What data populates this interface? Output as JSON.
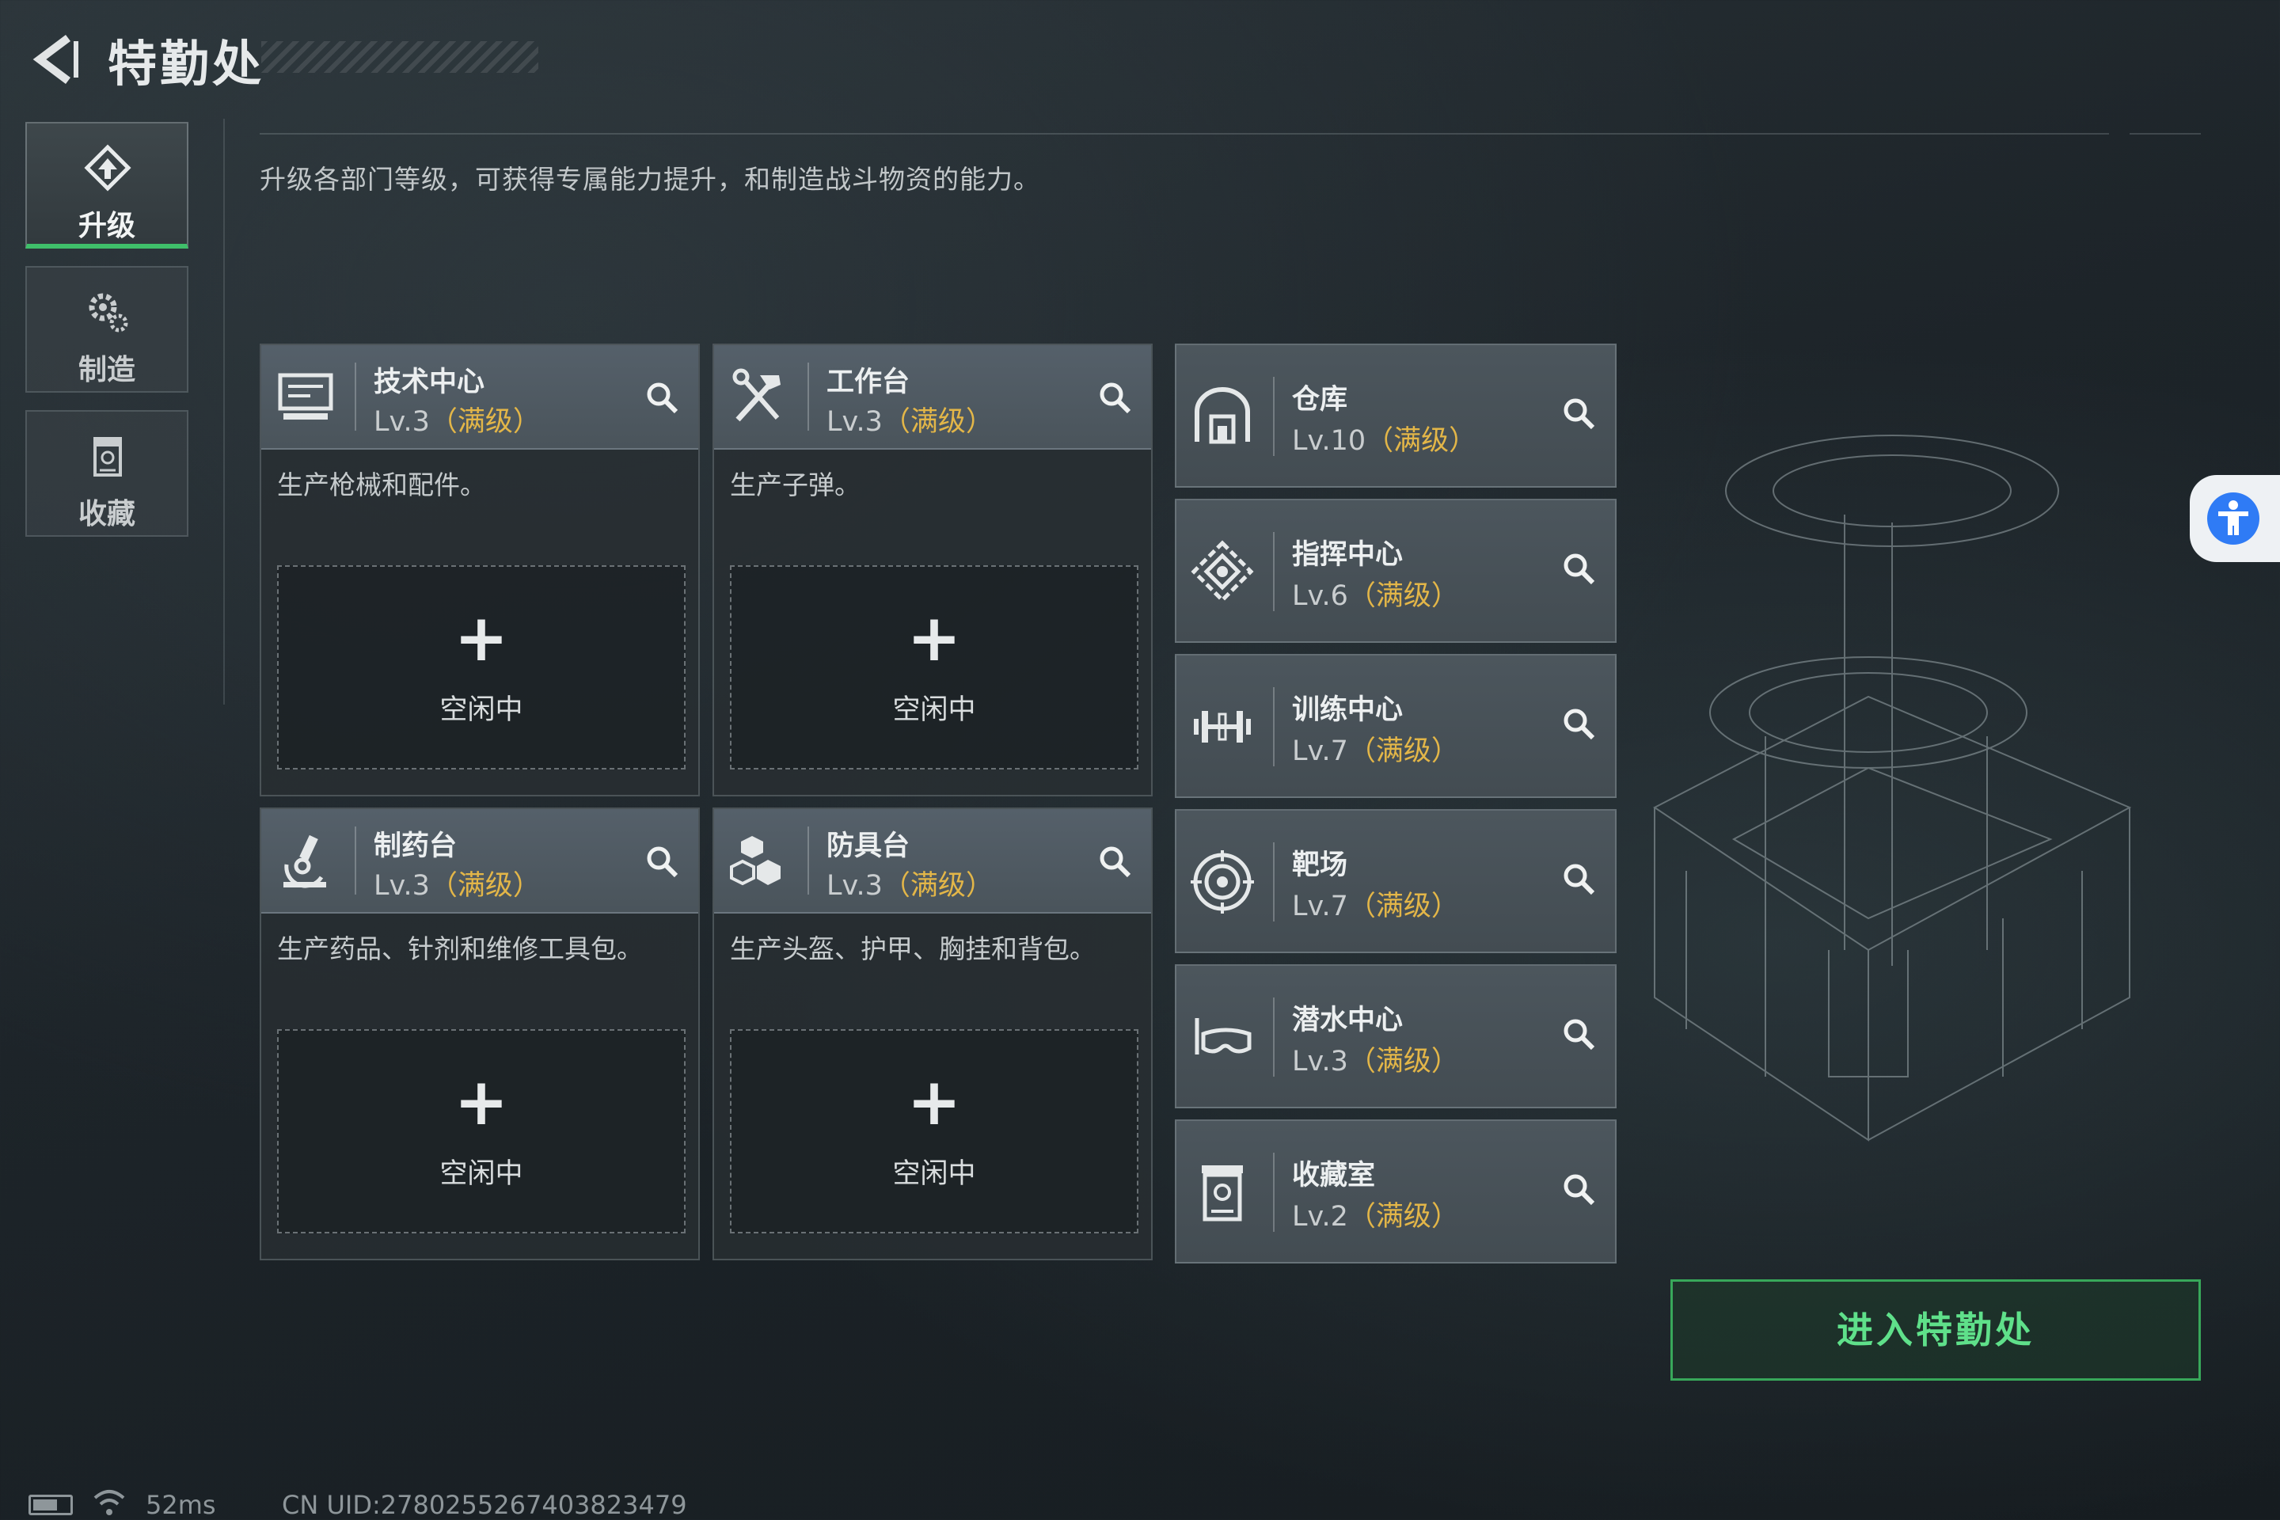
{
  "header": {
    "title": "特勤处"
  },
  "sidebar": {
    "tabs": [
      {
        "label": "升级",
        "icon": "upgrade-icon",
        "active": true
      },
      {
        "label": "制造",
        "icon": "gears-icon",
        "active": false
      },
      {
        "label": "收藏",
        "icon": "collection-icon",
        "active": false
      }
    ]
  },
  "description": "升级各部门等级，可获得专属能力提升，和制造战斗物资的能力。",
  "workshops": [
    {
      "name": "技术中心",
      "level": "Lv.3",
      "max": "（满级）",
      "icon": "computer-icon",
      "desc": "生产枪械和配件。",
      "slot_status": "空闲中",
      "slot_plus": "+"
    },
    {
      "name": "工作台",
      "level": "Lv.3",
      "max": "（满级）",
      "icon": "tools-icon",
      "desc": "生产子弹。",
      "slot_status": "空闲中",
      "slot_plus": "+"
    },
    {
      "name": "制药台",
      "level": "Lv.3",
      "max": "（满级）",
      "icon": "microscope-icon",
      "desc": "生产药品、针剂和维修工具包。",
      "slot_status": "空闲中",
      "slot_plus": "+"
    },
    {
      "name": "防具台",
      "level": "Lv.3",
      "max": "（满级）",
      "icon": "armor-blocks-icon",
      "desc": "生产头盔、护甲、胸挂和背包。",
      "slot_status": "空闲中",
      "slot_plus": "+"
    }
  ],
  "facilities": [
    {
      "name": "仓库",
      "level": "Lv.10",
      "max": "（满级）",
      "icon": "warehouse-icon"
    },
    {
      "name": "指挥中心",
      "level": "Lv.6",
      "max": "（满级）",
      "icon": "command-icon"
    },
    {
      "name": "训练中心",
      "level": "Lv.7",
      "max": "（满级）",
      "icon": "dumbbell-icon"
    },
    {
      "name": "靶场",
      "level": "Lv.7",
      "max": "（满级）",
      "icon": "target-icon"
    },
    {
      "name": "潜水中心",
      "level": "Lv.3",
      "max": "（满级）",
      "icon": "diving-mask-icon"
    },
    {
      "name": "收藏室",
      "level": "Lv.2",
      "max": "（满级）",
      "icon": "collection-room-icon"
    }
  ],
  "enter_button": "进入特勤处",
  "status": {
    "ping": "52ms",
    "uid": "CN UID:2780255267403823479"
  },
  "colors": {
    "accent_green": "#3fbf6a",
    "max_level_gold": "#e3b648",
    "access_blue": "#2f7bf5"
  }
}
